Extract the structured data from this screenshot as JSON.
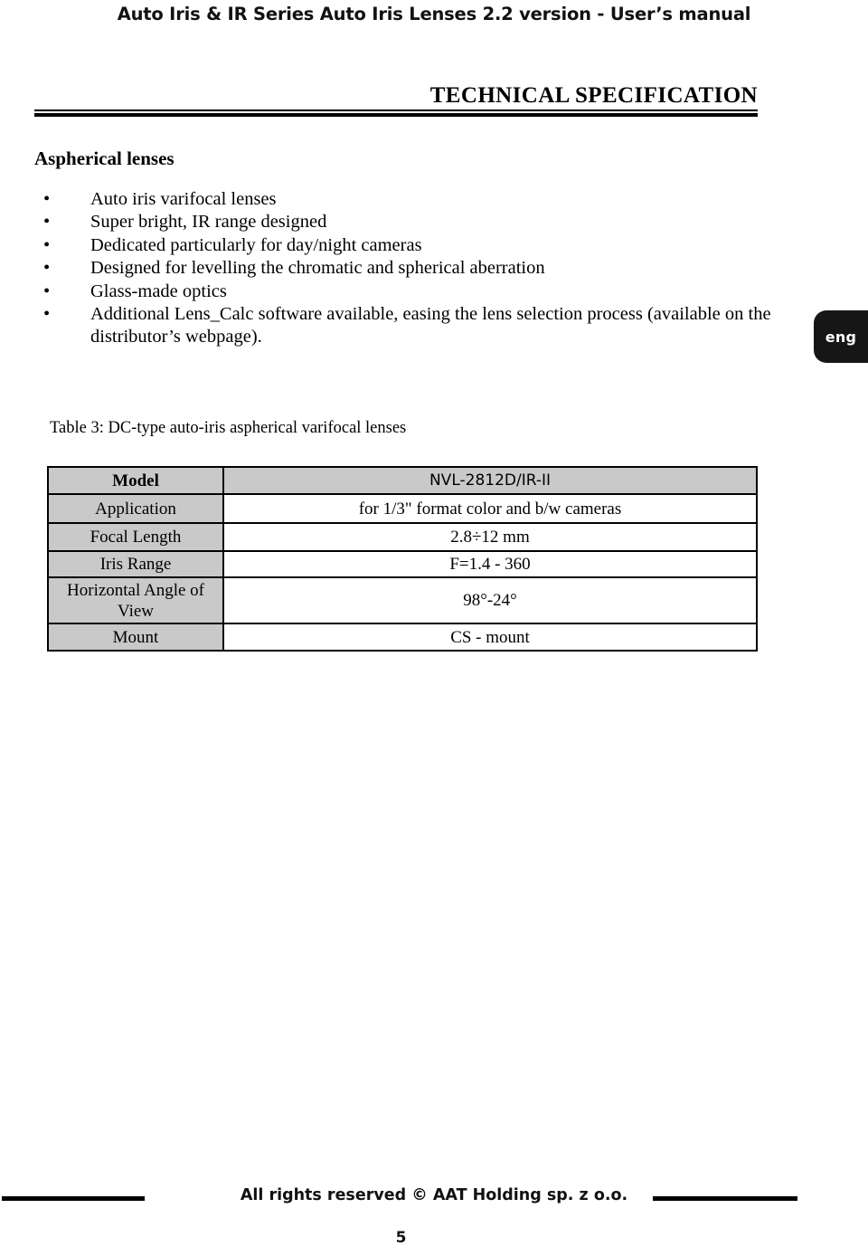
{
  "document": {
    "running_header": "Auto Iris & IR Series Auto Iris Lenses 2.2 version - User’s manual",
    "section_title": "TECHNICAL SPECIFICATION",
    "sub_heading": "Aspherical lenses",
    "page_number": "5",
    "footer_text": "All rights reserved © AAT Holding sp. z o.o.",
    "language_tab": "eng",
    "bullet_glyph": "•"
  },
  "features": [
    "Auto iris varifocal lenses",
    "Super bright, IR range designed",
    "Dedicated particularly for day/night cameras",
    "Designed for levelling the chromatic and spherical aberration",
    "Glass-made optics",
    "Additional Lens_Calc software available, easing the lens selection process (available on the distributor’s webpage)."
  ],
  "table": {
    "caption": "Table 3: DC-type auto-iris aspherical varifocal lenses",
    "rows": [
      {
        "label": "Model",
        "value": "NVL-2812D/IR-II"
      },
      {
        "label": "Application",
        "value": "for 1/3\" format color and b/w cameras"
      },
      {
        "label": "Focal Length",
        "value": "2.8÷12 mm"
      },
      {
        "label": "Iris Range",
        "value": "F=1.4 - 360"
      },
      {
        "label": "Horizontal Angle of View",
        "value": "98°-24°"
      },
      {
        "label": "Mount",
        "value": "CS - mount"
      }
    ]
  },
  "colors": {
    "label_cell_background": "#c9c9c9",
    "border": "#000000",
    "language_tab_background": "#161616",
    "text": "#000000"
  }
}
